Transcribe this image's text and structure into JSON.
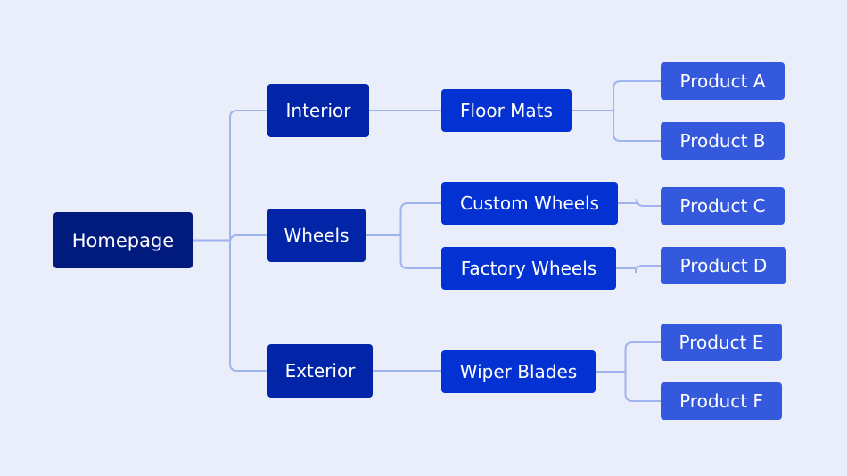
{
  "diagram": {
    "type": "sitemap-tree",
    "colors": {
      "background": "#eaeefa",
      "root": "#011a7d",
      "level1": "#0225a8",
      "level2": "#0432d2",
      "level3": "#3459dc",
      "connector": "#a1b3ef",
      "text": "#ffffff"
    },
    "root": {
      "label": "Homepage",
      "children": [
        {
          "label": "Interior",
          "children": [
            {
              "label": "Floor Mats",
              "children": [
                {
                  "label": "Product A"
                },
                {
                  "label": "Product B"
                }
              ]
            }
          ]
        },
        {
          "label": "Wheels",
          "children": [
            {
              "label": "Custom Wheels",
              "children": [
                {
                  "label": "Product C"
                }
              ]
            },
            {
              "label": "Factory Wheels",
              "children": [
                {
                  "label": "Product D"
                }
              ]
            }
          ]
        },
        {
          "label": "Exterior",
          "children": [
            {
              "label": "Wiper Blades",
              "children": [
                {
                  "label": "Product E"
                },
                {
                  "label": "Product F"
                }
              ]
            }
          ]
        }
      ]
    }
  }
}
